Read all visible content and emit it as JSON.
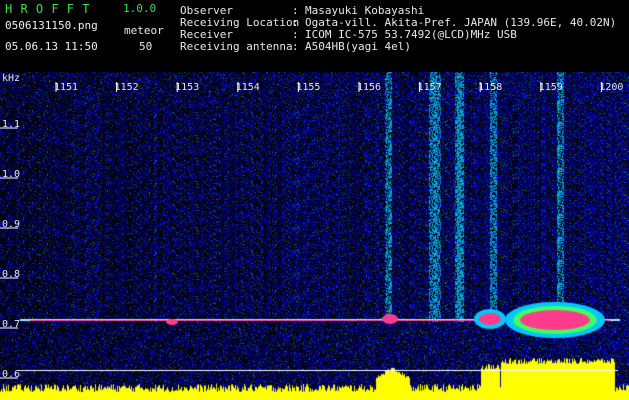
{
  "app": {
    "title": "H R O F F T",
    "version": "1.0.0"
  },
  "file": {
    "name": "0506131150.png",
    "datetime": "05.06.13 11:50"
  },
  "meteor": {
    "label": "meteor",
    "count": "50"
  },
  "info": [
    {
      "key": "Observer",
      "value": "Masayuki Kobayashi"
    },
    {
      "key": "Receiving Location",
      "value": "Ogata-vill. Akita-Pref. JAPAN (139.96E, 40.02N)"
    },
    {
      "key": "Receiver",
      "value": "ICOM IC-575 53.7492(@LCD)MHz USB"
    },
    {
      "key": "Receiving antenna",
      "value": "A504HB(yagi 4el)"
    }
  ],
  "info_separator": ":",
  "axis": {
    "unit": "kHz",
    "y_ticks": [
      "1.1",
      "1.0",
      "0.9",
      "0.8",
      "0.7",
      "0.6"
    ],
    "x_ticks": [
      "1151",
      "1152",
      "1153",
      "1154",
      "1155",
      "1156",
      "1157",
      "1158",
      "1159",
      "1200"
    ]
  },
  "colors": {
    "title": "#3ee03e",
    "text": "#e8e8e8",
    "noise": "#0a1a8a",
    "echo": "#ff3c8c",
    "power": "#ffff00"
  }
}
